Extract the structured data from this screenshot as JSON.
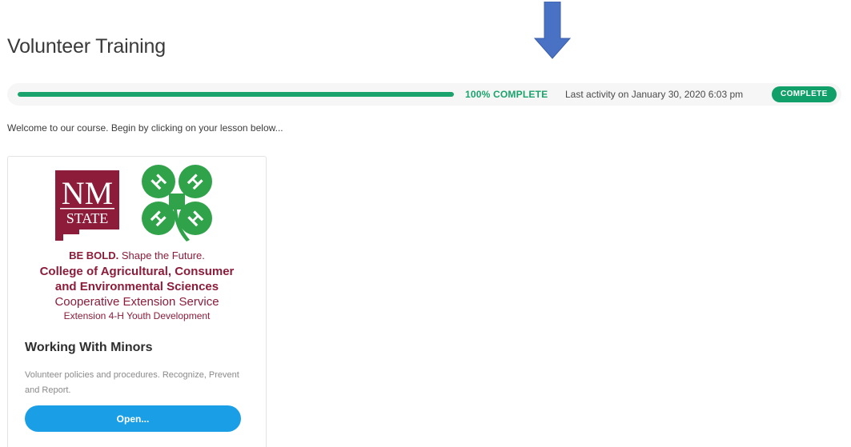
{
  "page": {
    "title": "Volunteer Training"
  },
  "annotation": {
    "arrow_icon": "down-arrow-icon",
    "arrow_color": "#4a72c4"
  },
  "progress": {
    "percent": 100,
    "percent_label": "100% COMPLETE",
    "last_activity": "Last activity on January 30, 2020 6:03 pm",
    "status_badge": "COMPLETE",
    "accent_color": "#1aa36c"
  },
  "course": {
    "welcome_text": "Welcome to our course. Begin by clicking on your lesson below..."
  },
  "lesson_card": {
    "logo_nm": "NM",
    "logo_state": "STATE",
    "clover_h": "H",
    "brand_color": "#8c1c3a",
    "tagline_bold": "BE BOLD.",
    "tagline_rest": " Shape the Future.",
    "college_line1": "College of Agricultural, Consumer",
    "college_line2": "and Environmental Sciences",
    "service": "Cooperative Extension Service",
    "program": "Extension 4-H Youth Development",
    "title": "Working With Minors",
    "description": "Volunteer policies and procedures. Recognize, Prevent and Report.",
    "open_label": "Open...",
    "button_color": "#1a9fe6"
  }
}
